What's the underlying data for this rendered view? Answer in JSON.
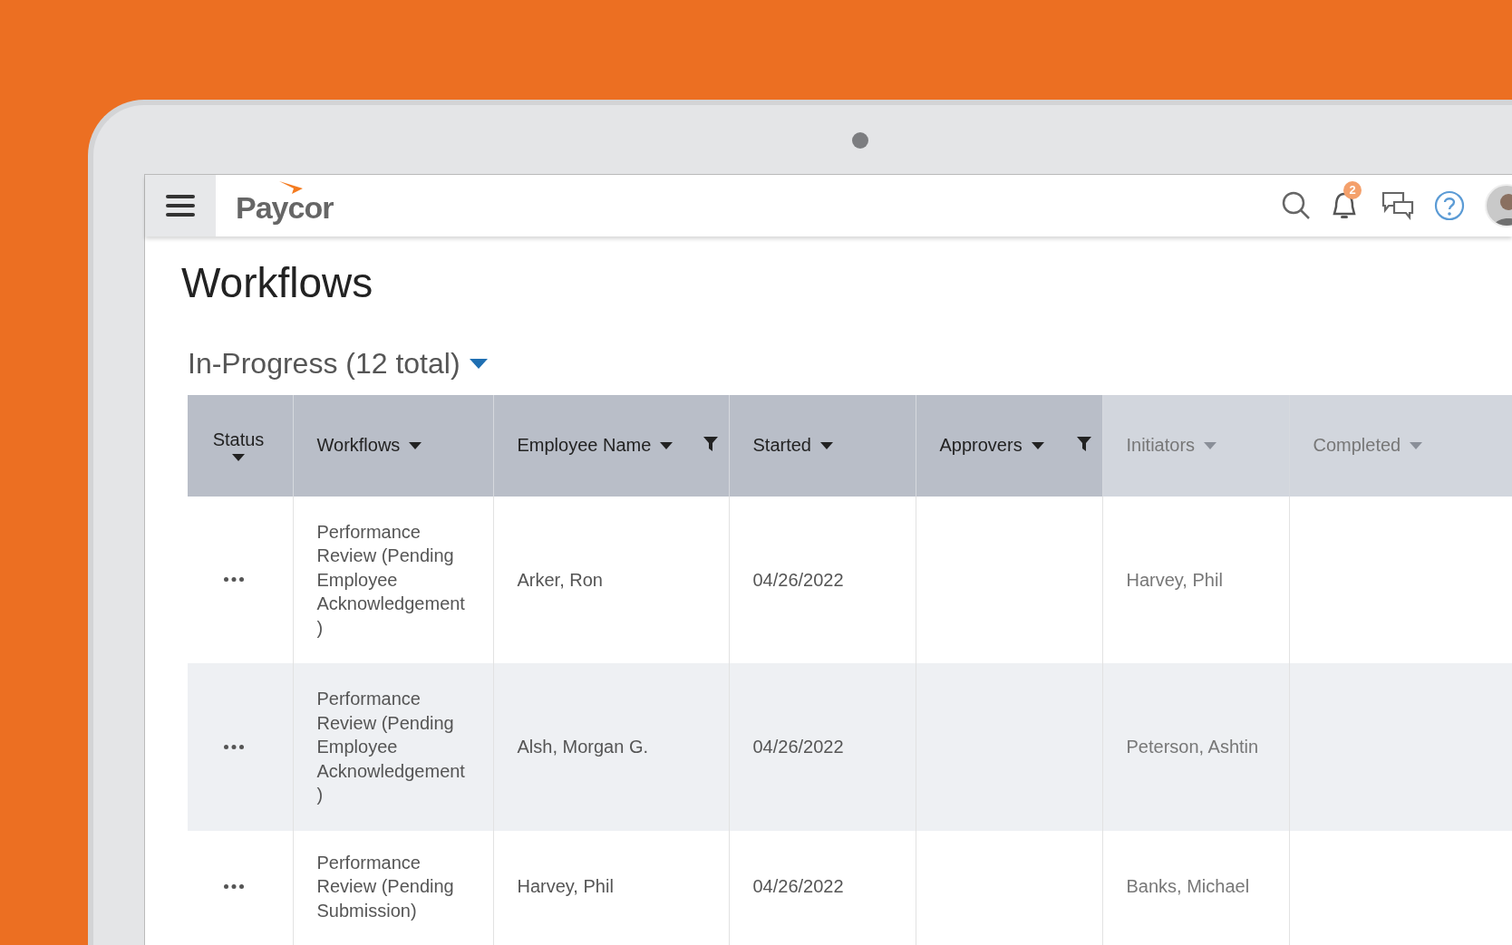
{
  "header": {
    "logo": "Paycor",
    "notifications": {
      "count": "2"
    }
  },
  "page": {
    "title": "Workflows",
    "filter": "In-Progress (12 total)"
  },
  "table": {
    "columns": [
      {
        "label": "Status",
        "filter": false
      },
      {
        "label": "Workflows",
        "filter": false
      },
      {
        "label": "Employee Name",
        "filter": true
      },
      {
        "label": "Started",
        "filter": false
      },
      {
        "label": "Approvers",
        "filter": true
      },
      {
        "label": "Initiators",
        "filter": false
      },
      {
        "label": "Completed",
        "filter": false
      }
    ],
    "rows": [
      {
        "workflow": "Performance Review (Pending Employee Acknowledgement )",
        "employee": "Arker, Ron",
        "started": "04/26/2022",
        "initiator": "Harvey, Phil"
      },
      {
        "workflow": "Performance Review (Pending Employee Acknowledgement )",
        "employee": "Alsh, Morgan G.",
        "started": "04/26/2022",
        "initiator": "Peterson, Ashtin"
      },
      {
        "workflow": "Performance Review (Pending Submission)",
        "employee": "Harvey, Phil",
        "started": "04/26/2022",
        "initiator": "Banks, Michael"
      }
    ]
  }
}
